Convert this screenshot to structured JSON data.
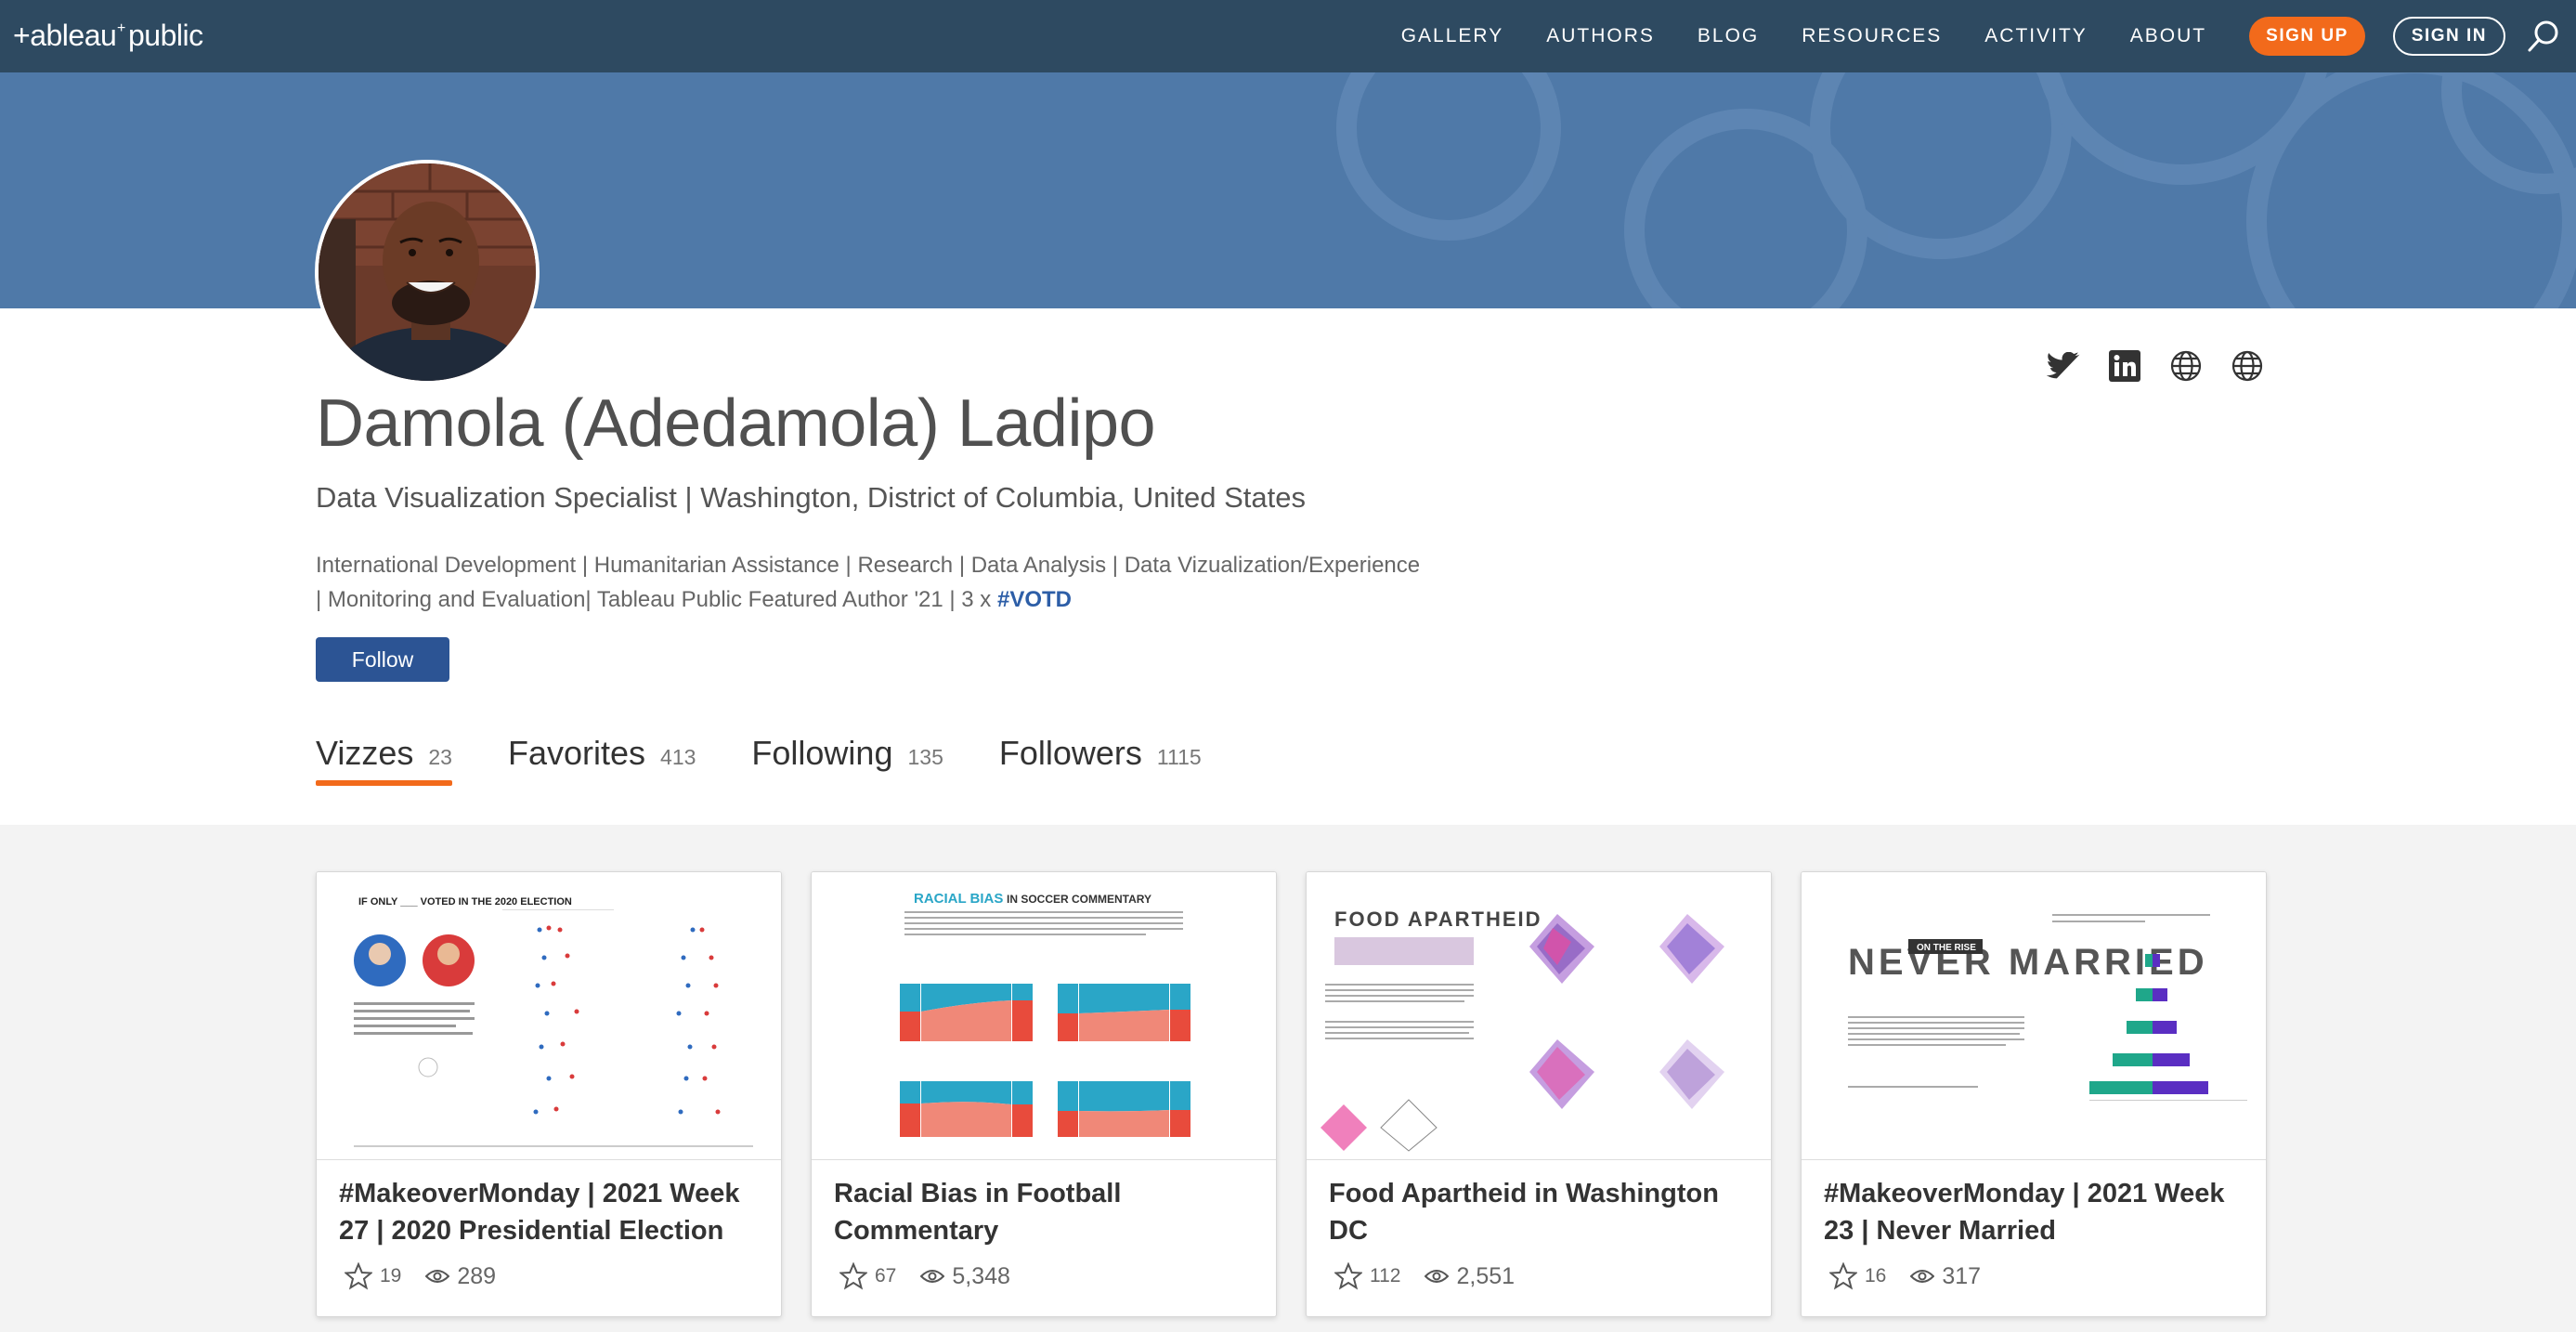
{
  "nav": {
    "logo": "+ableau+public",
    "links": [
      "GALLERY",
      "AUTHORS",
      "BLOG",
      "RESOURCES",
      "ACTIVITY",
      "ABOUT"
    ],
    "signup": "SIGN UP",
    "signin": "SIGN IN",
    "search_icon": "search-icon"
  },
  "colors": {
    "nav_bg": "#2e4a61",
    "banner_bg": "#4f79a8",
    "accent": "#f26a1b",
    "follow_bg": "#2c5494",
    "hashtag": "#2d5ea7"
  },
  "profile": {
    "name": "Damola (Adedamola) Ladipo",
    "subtitle": "Data Visualization Specialist | Washington, District of Columbia, United States",
    "bio_line1": "International Development | Humanitarian Assistance | Research | Data Analysis | Data Vizualization/Experience",
    "bio_line2": "| Monitoring and Evaluation| Tableau Public Featured Author '21 | 3 x ",
    "bio_tag": "#VOTD",
    "follow": "Follow",
    "social_icons": [
      "twitter-icon",
      "linkedin-icon",
      "globe-icon",
      "globe-icon"
    ]
  },
  "tabs": [
    {
      "label": "Vizzes",
      "count": "23"
    },
    {
      "label": "Favorites",
      "count": "413"
    },
    {
      "label": "Following",
      "count": "135"
    },
    {
      "label": "Followers",
      "count": "1115"
    }
  ],
  "cards": [
    {
      "title": "#MakeoverMonday | 2021 Week 27 | 2020 Presidential Election",
      "favorites": "19",
      "views": "289",
      "thumb_heading": "IF ONLY ___ VOTED IN THE 2020 ELECTION"
    },
    {
      "title": "Racial Bias in Football Commentary",
      "favorites": "67",
      "views": "5,348",
      "thumb_heading_a": "RACIAL BIAS",
      "thumb_heading_b": "IN SOCCER COMMENTARY"
    },
    {
      "title": "Food Apartheid in Washington DC",
      "favorites": "112",
      "views": "2,551",
      "thumb_heading": "FOOD APARTHEID"
    },
    {
      "title": "#MakeoverMonday | 2021 Week 23 | Never Married",
      "favorites": "16",
      "views": "317",
      "thumb_heading": "NEVER MARRIED",
      "thumb_sub": "ON THE RISE"
    }
  ]
}
